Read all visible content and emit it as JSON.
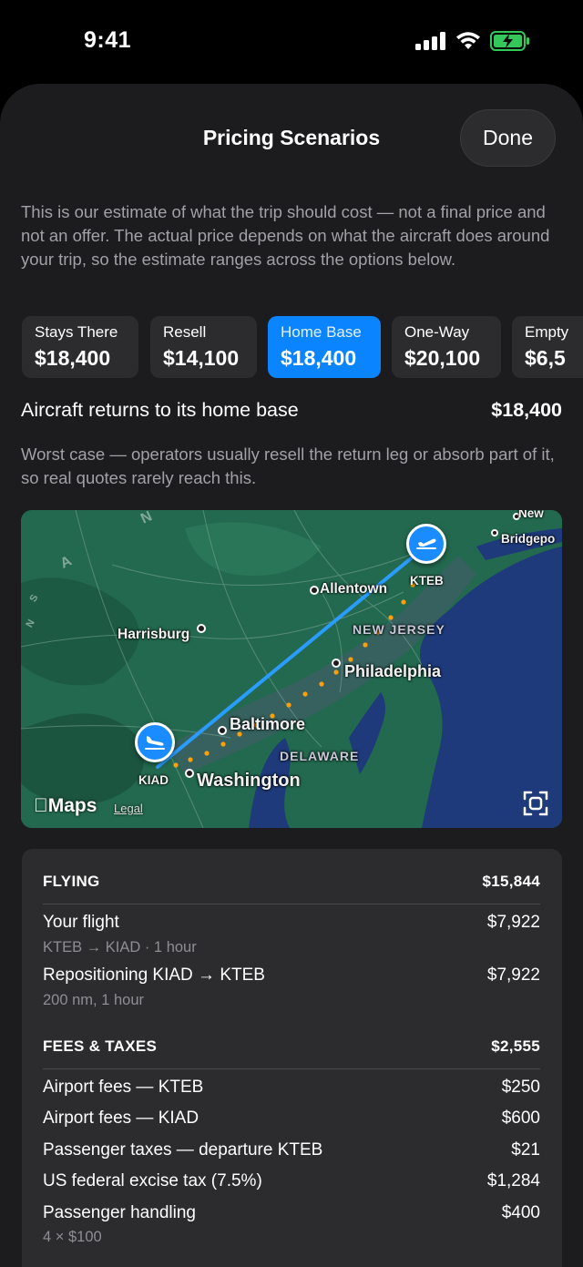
{
  "status_bar": {
    "time": "9:41"
  },
  "sheet": {
    "title": "Pricing Scenarios",
    "done_label": "Done"
  },
  "intro": "This is our estimate of what the trip should cost — not a final price and not an offer. The actual price depends on what the aircraft does around your trip, so the estimate ranges across the options below.",
  "scenarios": [
    {
      "label": "Stays There",
      "price": "$18,400"
    },
    {
      "label": "Resell",
      "price": "$14,100"
    },
    {
      "label": "Home Base",
      "price": "$18,400",
      "selected": true
    },
    {
      "label": "One-Way",
      "price": "$20,100"
    },
    {
      "label": "Empty",
      "price": "$6,5"
    }
  ],
  "selected_scenario": {
    "title": "Aircraft returns to its home base",
    "price": "$18,400",
    "note": "Worst case — operators usually resell the return leg or absorb part of it, so real quotes rarely reach this."
  },
  "map": {
    "labels": {
      "new": "New",
      "bridgeport": "Bridgepo",
      "allentown": "Allentown",
      "kteb": "KTEB",
      "harrisburg": "Harrisburg",
      "new_jersey": "NEW JERSEY",
      "philadelphia": "Philadelphia",
      "baltimore": "Baltimore",
      "delaware": "DELAWARE",
      "kiad": "KIAD",
      "washington": "Washington"
    },
    "brand": "Maps",
    "legal": "Legal",
    "colors": {
      "land": "#23694f",
      "water": "#1e3a7a",
      "route": "#2b9cff",
      "reposition": "#ff9f0a"
    }
  },
  "breakdown": {
    "flying": {
      "header": "FLYING",
      "total": "$15,844",
      "items": [
        {
          "label": "Your flight",
          "amount": "$7,922",
          "sub": "KTEB → KIAD · 1 hour"
        },
        {
          "label": "Repositioning KIAD → KTEB",
          "amount": "$7,922",
          "sub": "200 nm, 1 hour"
        }
      ]
    },
    "fees": {
      "header": "FEES & TAXES",
      "total": "$2,555",
      "items": [
        {
          "label": "Airport fees — KTEB",
          "amount": "$250"
        },
        {
          "label": "Airport fees — KIAD",
          "amount": "$600"
        },
        {
          "label": "Passenger taxes — departure KTEB",
          "amount": "$21"
        },
        {
          "label": "US federal excise tax (7.5%)",
          "amount": "$1,284"
        },
        {
          "label": "Passenger handling",
          "amount": "$400",
          "sub": "4 × $100"
        }
      ]
    }
  }
}
